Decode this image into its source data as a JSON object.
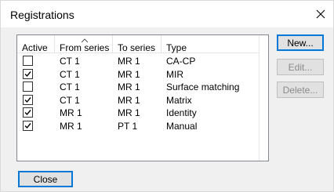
{
  "window": {
    "title": "Registrations"
  },
  "list": {
    "columns": [
      "Active",
      "From series",
      "To series",
      "Type"
    ],
    "rows": [
      {
        "active": false,
        "from": "CT 1",
        "to": "MR 1",
        "type": "CA-CP"
      },
      {
        "active": true,
        "from": "CT 1",
        "to": "MR 1",
        "type": "MIR"
      },
      {
        "active": false,
        "from": "CT 1",
        "to": "MR 1",
        "type": "Surface matching"
      },
      {
        "active": true,
        "from": "CT 1",
        "to": "MR 1",
        "type": "Matrix"
      },
      {
        "active": true,
        "from": "MR 1",
        "to": "MR 1",
        "type": "Identity"
      },
      {
        "active": true,
        "from": "MR 1",
        "to": "PT 1",
        "type": "Manual"
      }
    ]
  },
  "buttons": {
    "new": "New...",
    "edit": "Edit...",
    "delete": "Delete...",
    "close": "Close"
  },
  "colors": {
    "accent": "#0078d7",
    "disabled_text": "#8b8b8b"
  },
  "icons": {
    "close": "close-icon",
    "check": "checkmark-icon",
    "sort": "sort-ascending-icon"
  }
}
